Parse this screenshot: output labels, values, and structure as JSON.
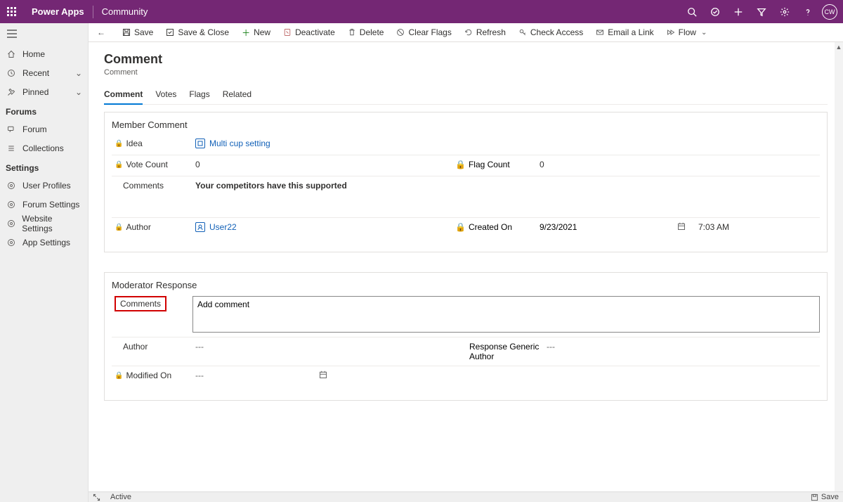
{
  "topbar": {
    "brand": "Power Apps",
    "env": "Community",
    "avatar": "CW"
  },
  "sidebar": {
    "home": "Home",
    "recent": "Recent",
    "pinned": "Pinned",
    "groups": {
      "forums": "Forums",
      "settings": "Settings"
    },
    "forum": "Forum",
    "collections": "Collections",
    "user_profiles": "User Profiles",
    "forum_settings": "Forum Settings",
    "website_settings": "Website Settings",
    "app_settings": "App Settings"
  },
  "cmd": {
    "save": "Save",
    "save_close": "Save & Close",
    "new": "New",
    "deactivate": "Deactivate",
    "delete": "Delete",
    "clear_flags": "Clear Flags",
    "refresh": "Refresh",
    "check_access": "Check Access",
    "email_link": "Email a Link",
    "flow": "Flow"
  },
  "page": {
    "title": "Comment",
    "subtitle": "Comment"
  },
  "tabs": {
    "comment": "Comment",
    "votes": "Votes",
    "flags": "Flags",
    "related": "Related"
  },
  "member": {
    "section": "Member Comment",
    "idea_label": "Idea",
    "idea_value": "Multi cup setting",
    "vote_label": "Vote Count",
    "vote_value": "0",
    "flag_label": "Flag Count",
    "flag_value": "0",
    "comments_label": "Comments",
    "comments_value": "Your competitors have this supported",
    "author_label": "Author",
    "author_value": "User22",
    "created_label": "Created On",
    "created_date": "9/23/2021",
    "created_time": "7:03 AM"
  },
  "mod": {
    "section": "Moderator Response",
    "comments_label": "Comments",
    "comments_value": "Add comment",
    "author_label": "Author",
    "author_value": "---",
    "generic_label": "Response Generic Author",
    "generic_value": "---",
    "modified_label": "Modified On",
    "modified_value": "---"
  },
  "status": {
    "state": "Active",
    "save": "Save"
  }
}
